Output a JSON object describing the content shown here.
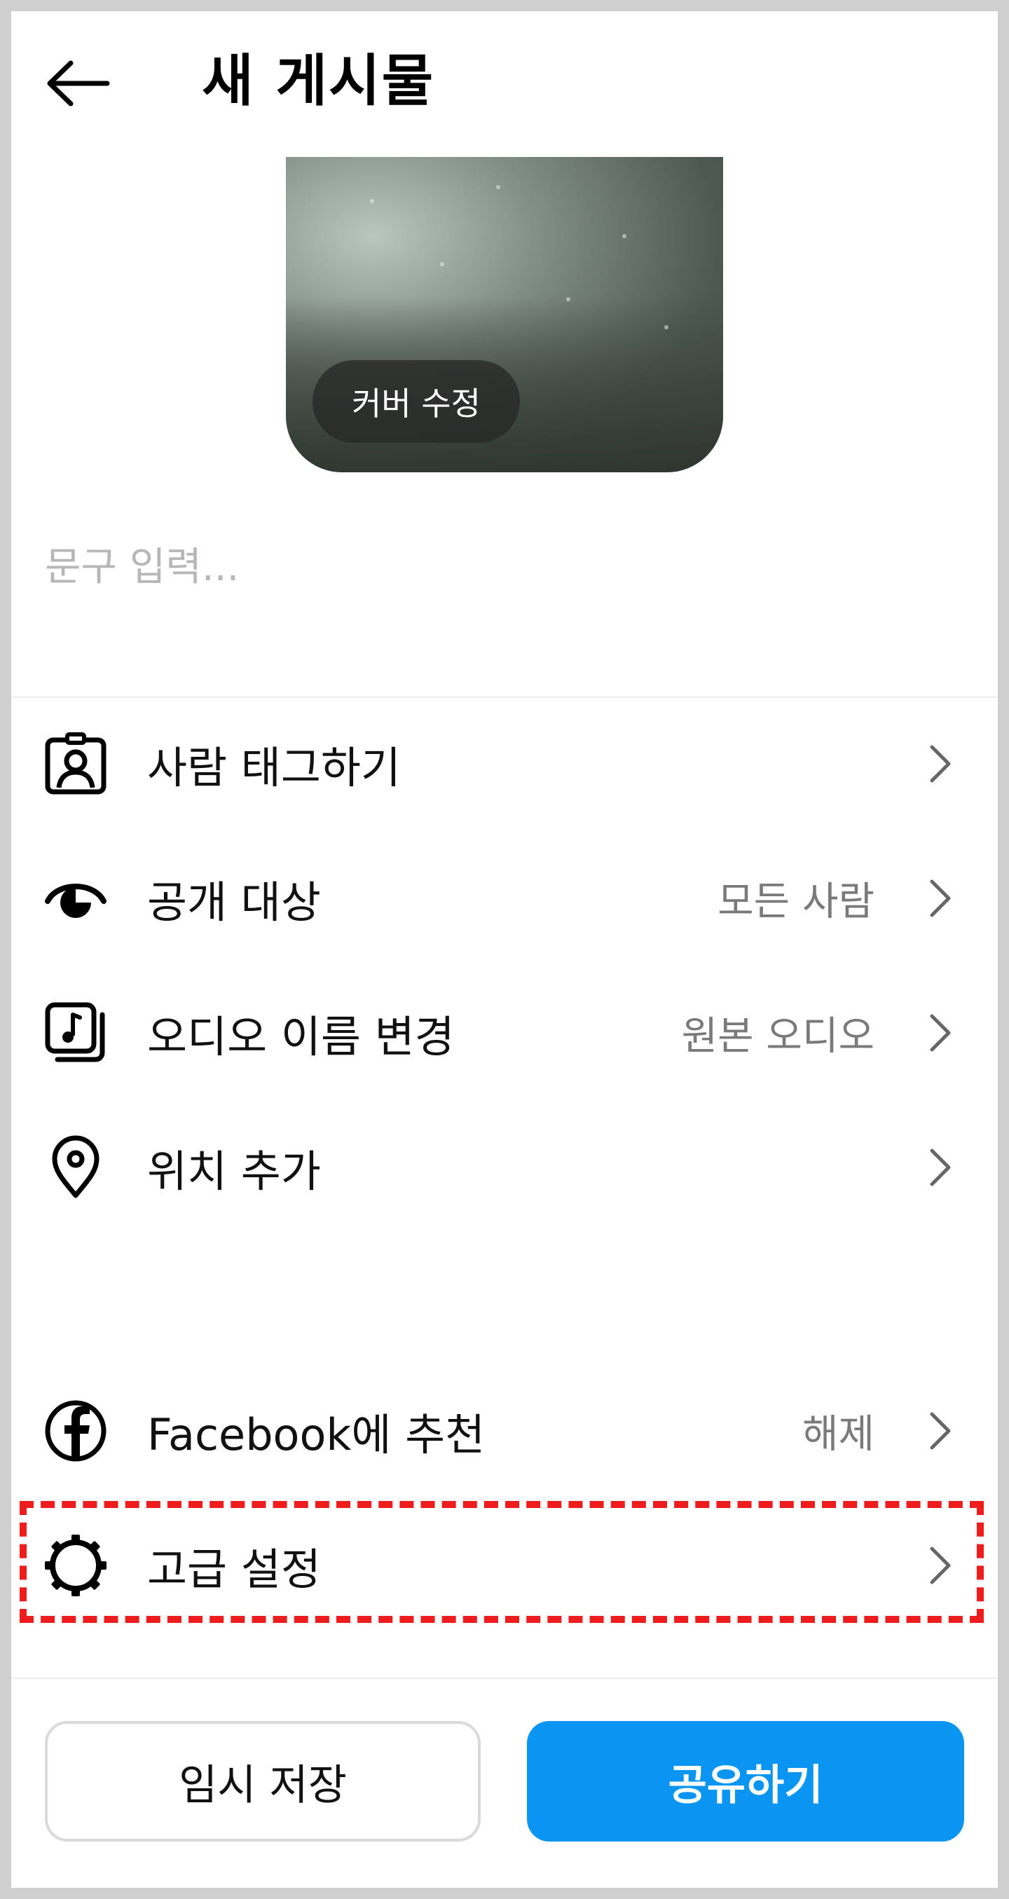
{
  "header": {
    "title": "새 게시물"
  },
  "cover": {
    "edit_label": "커버 수정"
  },
  "caption": {
    "placeholder": "문구 입력..."
  },
  "menu": [
    {
      "icon": "tag-person-icon",
      "label": "사람 태그하기",
      "value": ""
    },
    {
      "icon": "audience-eye-icon",
      "label": "공개 대상",
      "value": "모든 사람"
    },
    {
      "icon": "audio-icon",
      "label": "오디오 이름 변경",
      "value": "원본 오디오"
    },
    {
      "icon": "location-pin-icon",
      "label": "위치 추가",
      "value": ""
    }
  ],
  "share_menu": [
    {
      "icon": "facebook-icon",
      "label": "Facebook에 추천",
      "value": "해제"
    },
    {
      "icon": "gear-icon",
      "label": "고급 설정",
      "value": ""
    }
  ],
  "buttons": {
    "draft": "임시 저장",
    "share": "공유하기"
  },
  "colors": {
    "accent": "#0a95f2",
    "highlight": "#ee1c1c"
  }
}
